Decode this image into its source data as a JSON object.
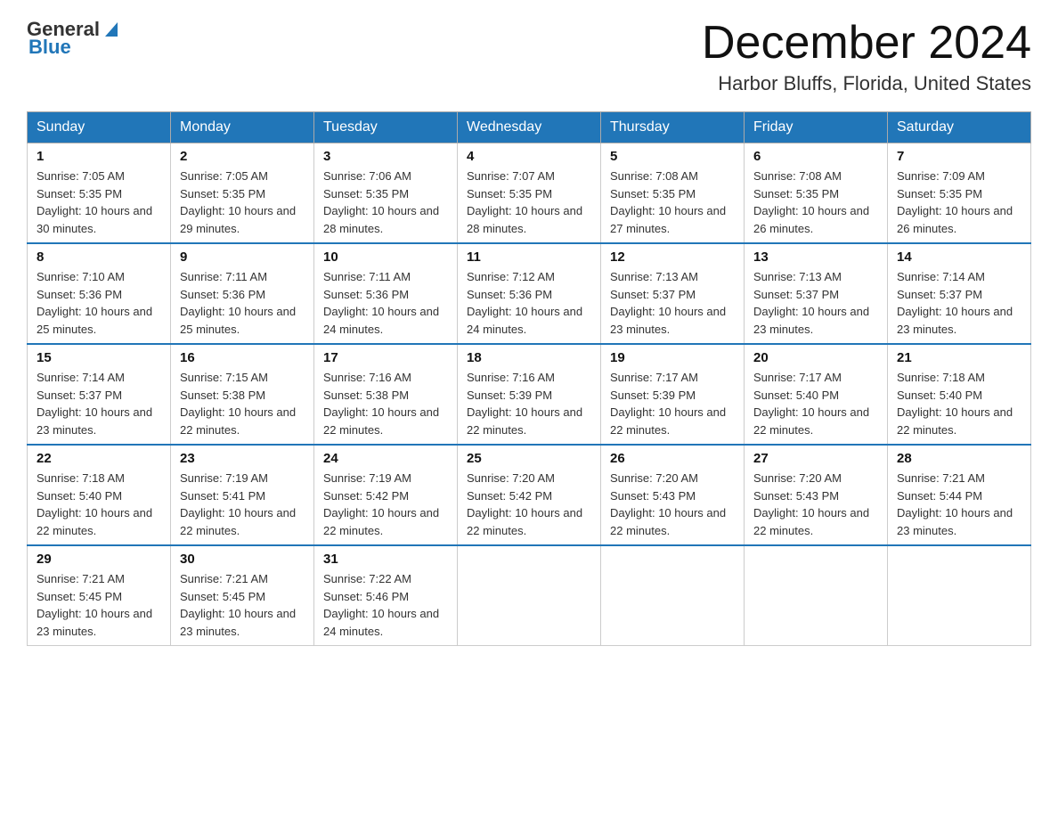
{
  "header": {
    "logo_general": "General",
    "logo_blue": "Blue",
    "title": "December 2024",
    "subtitle": "Harbor Bluffs, Florida, United States"
  },
  "days_of_week": [
    "Sunday",
    "Monday",
    "Tuesday",
    "Wednesday",
    "Thursday",
    "Friday",
    "Saturday"
  ],
  "weeks": [
    [
      {
        "day": "1",
        "sunrise": "7:05 AM",
        "sunset": "5:35 PM",
        "daylight": "10 hours and 30 minutes."
      },
      {
        "day": "2",
        "sunrise": "7:05 AM",
        "sunset": "5:35 PM",
        "daylight": "10 hours and 29 minutes."
      },
      {
        "day": "3",
        "sunrise": "7:06 AM",
        "sunset": "5:35 PM",
        "daylight": "10 hours and 28 minutes."
      },
      {
        "day": "4",
        "sunrise": "7:07 AM",
        "sunset": "5:35 PM",
        "daylight": "10 hours and 28 minutes."
      },
      {
        "day": "5",
        "sunrise": "7:08 AM",
        "sunset": "5:35 PM",
        "daylight": "10 hours and 27 minutes."
      },
      {
        "day": "6",
        "sunrise": "7:08 AM",
        "sunset": "5:35 PM",
        "daylight": "10 hours and 26 minutes."
      },
      {
        "day": "7",
        "sunrise": "7:09 AM",
        "sunset": "5:35 PM",
        "daylight": "10 hours and 26 minutes."
      }
    ],
    [
      {
        "day": "8",
        "sunrise": "7:10 AM",
        "sunset": "5:36 PM",
        "daylight": "10 hours and 25 minutes."
      },
      {
        "day": "9",
        "sunrise": "7:11 AM",
        "sunset": "5:36 PM",
        "daylight": "10 hours and 25 minutes."
      },
      {
        "day": "10",
        "sunrise": "7:11 AM",
        "sunset": "5:36 PM",
        "daylight": "10 hours and 24 minutes."
      },
      {
        "day": "11",
        "sunrise": "7:12 AM",
        "sunset": "5:36 PM",
        "daylight": "10 hours and 24 minutes."
      },
      {
        "day": "12",
        "sunrise": "7:13 AM",
        "sunset": "5:37 PM",
        "daylight": "10 hours and 23 minutes."
      },
      {
        "day": "13",
        "sunrise": "7:13 AM",
        "sunset": "5:37 PM",
        "daylight": "10 hours and 23 minutes."
      },
      {
        "day": "14",
        "sunrise": "7:14 AM",
        "sunset": "5:37 PM",
        "daylight": "10 hours and 23 minutes."
      }
    ],
    [
      {
        "day": "15",
        "sunrise": "7:14 AM",
        "sunset": "5:37 PM",
        "daylight": "10 hours and 23 minutes."
      },
      {
        "day": "16",
        "sunrise": "7:15 AM",
        "sunset": "5:38 PM",
        "daylight": "10 hours and 22 minutes."
      },
      {
        "day": "17",
        "sunrise": "7:16 AM",
        "sunset": "5:38 PM",
        "daylight": "10 hours and 22 minutes."
      },
      {
        "day": "18",
        "sunrise": "7:16 AM",
        "sunset": "5:39 PM",
        "daylight": "10 hours and 22 minutes."
      },
      {
        "day": "19",
        "sunrise": "7:17 AM",
        "sunset": "5:39 PM",
        "daylight": "10 hours and 22 minutes."
      },
      {
        "day": "20",
        "sunrise": "7:17 AM",
        "sunset": "5:40 PM",
        "daylight": "10 hours and 22 minutes."
      },
      {
        "day": "21",
        "sunrise": "7:18 AM",
        "sunset": "5:40 PM",
        "daylight": "10 hours and 22 minutes."
      }
    ],
    [
      {
        "day": "22",
        "sunrise": "7:18 AM",
        "sunset": "5:40 PM",
        "daylight": "10 hours and 22 minutes."
      },
      {
        "day": "23",
        "sunrise": "7:19 AM",
        "sunset": "5:41 PM",
        "daylight": "10 hours and 22 minutes."
      },
      {
        "day": "24",
        "sunrise": "7:19 AM",
        "sunset": "5:42 PM",
        "daylight": "10 hours and 22 minutes."
      },
      {
        "day": "25",
        "sunrise": "7:20 AM",
        "sunset": "5:42 PM",
        "daylight": "10 hours and 22 minutes."
      },
      {
        "day": "26",
        "sunrise": "7:20 AM",
        "sunset": "5:43 PM",
        "daylight": "10 hours and 22 minutes."
      },
      {
        "day": "27",
        "sunrise": "7:20 AM",
        "sunset": "5:43 PM",
        "daylight": "10 hours and 22 minutes."
      },
      {
        "day": "28",
        "sunrise": "7:21 AM",
        "sunset": "5:44 PM",
        "daylight": "10 hours and 23 minutes."
      }
    ],
    [
      {
        "day": "29",
        "sunrise": "7:21 AM",
        "sunset": "5:45 PM",
        "daylight": "10 hours and 23 minutes."
      },
      {
        "day": "30",
        "sunrise": "7:21 AM",
        "sunset": "5:45 PM",
        "daylight": "10 hours and 23 minutes."
      },
      {
        "day": "31",
        "sunrise": "7:22 AM",
        "sunset": "5:46 PM",
        "daylight": "10 hours and 24 minutes."
      },
      null,
      null,
      null,
      null
    ]
  ],
  "labels": {
    "sunrise_prefix": "Sunrise: ",
    "sunset_prefix": "Sunset: ",
    "daylight_prefix": "Daylight: "
  }
}
